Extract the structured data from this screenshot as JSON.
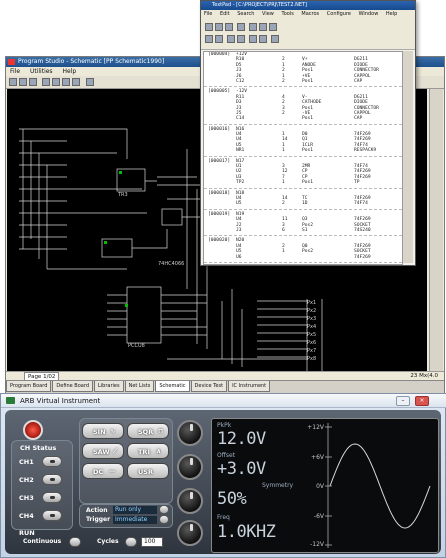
{
  "schematic": {
    "title": "Program Studio - Schematic [PP Schematic1990]",
    "menu": [
      "File",
      "Utilities",
      "Help"
    ],
    "component_labels": [
      "74HC4066",
      "TR3",
      "PCCU8"
    ],
    "status_left": "Page 1/02",
    "status_right": "23 Mx(4.0",
    "tabs": [
      "Program Board",
      "Define Board",
      "Libraries",
      "Net Lists",
      "Schematic",
      "Device Test",
      "IC Instrument"
    ]
  },
  "editor": {
    "title": "TextPad - [C:\\PROJECT\\PRJ\\TEST2.NET]",
    "menu": [
      "File",
      "Edit",
      "Search",
      "View",
      "Tools",
      "Macros",
      "Configure",
      "Window",
      "Help"
    ],
    "blocks": [
      {
        "id": "[000004]",
        "rows": [
          [
            "+12V",
            "",
            "",
            "",
            ""
          ],
          [
            "R10",
            "2",
            "V+",
            "",
            "DG211"
          ],
          [
            "D5",
            "1",
            "ANODE",
            "",
            "DIODE"
          ],
          [
            "J3",
            "2",
            "Pos1",
            "",
            "CONNECTOR"
          ],
          [
            "J6",
            "1",
            "+VE",
            "",
            "CAPPOL"
          ],
          [
            "C12",
            "2",
            "Pos1",
            "",
            "CAP"
          ]
        ]
      },
      {
        "id": "[000005]",
        "rows": [
          [
            "-12V",
            "",
            "",
            "",
            ""
          ],
          [
            "R11",
            "4",
            "V-",
            "",
            "DG211"
          ],
          [
            "D3",
            "2",
            "CATHODE",
            "",
            "DIODE"
          ],
          [
            "J3",
            "3",
            "Pos1",
            "",
            "CONNECTOR"
          ],
          [
            "J5",
            "2",
            "-VE",
            "",
            "CAPPOL"
          ],
          [
            "C14",
            "",
            "Pos1",
            "",
            "CAP"
          ]
        ]
      },
      {
        "id": "[000016]",
        "rows": [
          [
            "N16",
            "",
            "",
            "",
            ""
          ],
          [
            "U4",
            "1",
            "D0",
            "",
            "74F269"
          ],
          [
            "U4",
            "14",
            "Q1",
            "",
            "74F269"
          ],
          [
            "U5",
            "1",
            "1CLR",
            "",
            "74F74"
          ],
          [
            "NR1",
            "1",
            "Pos1",
            "",
            "RESPACK9"
          ]
        ]
      },
      {
        "id": "[000017]",
        "rows": [
          [
            "N17",
            "",
            "",
            "",
            ""
          ],
          [
            "U1",
            "3",
            "2MR",
            "",
            "74F74"
          ],
          [
            "U2",
            "12",
            "CP",
            "",
            "74F269"
          ],
          [
            "U3",
            "7",
            "CP",
            "",
            "74F269"
          ],
          [
            "TP2",
            "1",
            "Pos1",
            "",
            "TP"
          ]
        ]
      },
      {
        "id": "[000018]",
        "rows": [
          [
            "N18",
            "",
            "",
            "",
            ""
          ],
          [
            "U4",
            "14",
            "TC",
            "",
            "74F269"
          ],
          [
            "U5",
            "2",
            "1D",
            "",
            "74F74"
          ]
        ]
      },
      {
        "id": "[000019]",
        "rows": [
          [
            "N19",
            "",
            "",
            "",
            ""
          ],
          [
            "U4",
            "11",
            "Q3",
            "",
            "74F269"
          ],
          [
            "J2",
            "3",
            "Pos2",
            "",
            "SOCKET"
          ],
          [
            "J3",
            "6",
            "S1",
            "",
            "74S240"
          ]
        ]
      },
      {
        "id": "[000020]",
        "rows": [
          [
            "N20",
            "",
            "",
            "",
            ""
          ],
          [
            "U4",
            "2",
            "Q0",
            "",
            "74F269"
          ],
          [
            "U5",
            "1",
            "Pos2",
            "",
            "SOCKET"
          ],
          [
            "U6",
            "",
            "",
            "",
            "74F269"
          ]
        ]
      }
    ]
  },
  "arb": {
    "title": "ARB Virtual Instrument",
    "ch_status": "CH Status",
    "channels": [
      "CH1",
      "CH2",
      "CH3",
      "CH4"
    ],
    "run_label": "RUN",
    "continuous": "Continuous",
    "cycles": "Cycles",
    "cycles_value": "100",
    "waves": [
      {
        "label": "SIN",
        "symbol": "∿"
      },
      {
        "label": "SQR",
        "symbol": "⊓"
      },
      {
        "label": "SAW",
        "symbol": "⟋"
      },
      {
        "label": "TRI",
        "symbol": "∧"
      },
      {
        "label": "DC",
        "symbol": "—"
      },
      {
        "label": "USR",
        "symbol": ""
      }
    ],
    "action_label": "Action",
    "action_value": "Run only",
    "trigger_label": "Trigger",
    "trigger_value": "Immediate",
    "display": {
      "pkpk_label": "PkPk",
      "pkpk_value": "12.0V",
      "offset_label": "Offset",
      "offset_value": "+3.0V",
      "symmetry_label": "Symmetry",
      "symmetry_value": "50%",
      "freq_label": "Freq",
      "freq_value": "1.0KHZ",
      "axis": [
        "+12V",
        "+6V",
        "0V",
        "-6V",
        "-12V"
      ]
    }
  }
}
